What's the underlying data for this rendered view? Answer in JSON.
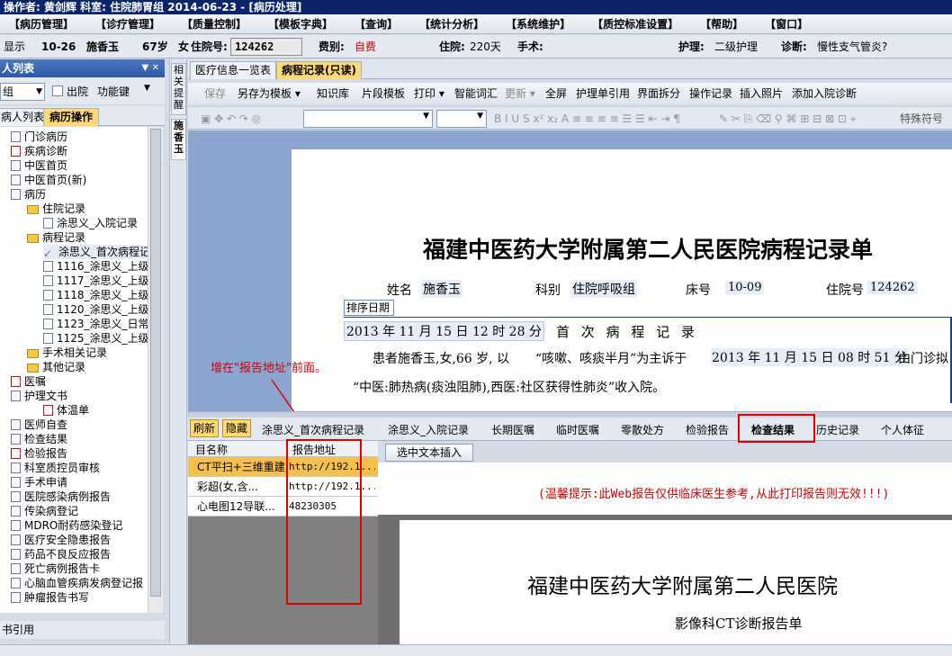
{
  "titlebar": {
    "text": "操作者: 黄剑辉  科室: 住院肺胃组  2014-06-23 - [病历处理]"
  },
  "menu": [
    "【病历管理】",
    "【诊疗管理】",
    "【质量控制】",
    "【模板字典】",
    "【查询】",
    "【统计分析】",
    "【系统维护】",
    "【质控标准设置】",
    "【帮助】",
    "【窗口】"
  ],
  "patient": {
    "show_label": "显示",
    "bed": "10-26",
    "name": "施香玉",
    "age": "67岁",
    "sex_label": "女",
    "admission_no_label": "住院号:",
    "admission_no": "124262",
    "fee_label": "费别:",
    "fee": "自费",
    "inpatient_label": "住院:",
    "inpatient": "220天",
    "surgery_label": "手术:",
    "nursing_label": "护理:",
    "nursing": "二级护理",
    "diagnosis_label": "诊断:",
    "diagnosis": "慢性支气管炎?"
  },
  "left": {
    "header": "人列表",
    "pin": "▼ ✕",
    "group_value": "组",
    "discharged_label": "出院",
    "function_key": "功能键",
    "tabs": [
      "病人列表",
      "病历操作"
    ],
    "tree": [
      {
        "label": "门诊病历",
        "indent": 0,
        "icon": "doc"
      },
      {
        "label": "疾病诊断",
        "indent": 0,
        "icon": "red"
      },
      {
        "label": "中医首页",
        "indent": 0,
        "icon": "doc"
      },
      {
        "label": "中医首页(新)",
        "indent": 0,
        "icon": "doc"
      },
      {
        "label": "病历",
        "indent": 0,
        "icon": "doc"
      },
      {
        "label": "住院记录",
        "indent": 1,
        "icon": "folder"
      },
      {
        "label": "涂思义_入院记录",
        "indent": 2,
        "icon": "doc"
      },
      {
        "label": "病程记录",
        "indent": 1,
        "icon": "folder"
      },
      {
        "label": "涂思义_首次病程记",
        "indent": 2,
        "icon": "check"
      },
      {
        "label": "1116_涂思义_上级",
        "indent": 2,
        "icon": "doc"
      },
      {
        "label": "1117_涂思义_上级",
        "indent": 2,
        "icon": "doc"
      },
      {
        "label": "1118_涂思义_上级",
        "indent": 2,
        "icon": "doc"
      },
      {
        "label": "1120_涂思义_上级",
        "indent": 2,
        "icon": "doc"
      },
      {
        "label": "1123_涂思义_日常",
        "indent": 2,
        "icon": "doc"
      },
      {
        "label": "1125_涂思义_上级",
        "indent": 2,
        "icon": "doc"
      },
      {
        "label": "手术相关记录",
        "indent": 1,
        "icon": "folder"
      },
      {
        "label": "其他记录",
        "indent": 1,
        "icon": "folder"
      },
      {
        "label": "医嘱",
        "indent": 0,
        "icon": "red"
      },
      {
        "label": "护理文书",
        "indent": 0,
        "icon": "doc"
      },
      {
        "label": "体温单",
        "indent": 2,
        "icon": "red"
      },
      {
        "label": "医师自查",
        "indent": 0,
        "icon": "doc"
      },
      {
        "label": "检查结果",
        "indent": 0,
        "icon": "doc"
      },
      {
        "label": "检验报告",
        "indent": 0,
        "icon": "red"
      },
      {
        "label": "科室质控员审核",
        "indent": 0,
        "icon": "doc"
      },
      {
        "label": "手术申请",
        "indent": 0,
        "icon": "doc"
      },
      {
        "label": "医院感染病例报告",
        "indent": 0,
        "icon": "doc"
      },
      {
        "label": "传染病登记",
        "indent": 0,
        "icon": "doc"
      },
      {
        "label": "MDRO耐药感染登记",
        "indent": 0,
        "icon": "doc"
      },
      {
        "label": "医疗安全隐患报告",
        "indent": 0,
        "icon": "doc"
      },
      {
        "label": "药品不良反应报告",
        "indent": 0,
        "icon": "doc"
      },
      {
        "label": "死亡病例报告卡",
        "indent": 0,
        "icon": "doc"
      },
      {
        "label": "心脑血管疾病发病登记报",
        "indent": 0,
        "icon": "doc"
      },
      {
        "label": "肿瘤报告书写",
        "indent": 0,
        "icon": "doc"
      }
    ],
    "footer": "书引用"
  },
  "sidetabs": [
    "相关提醒",
    "施香玉"
  ],
  "doc_tabs": [
    "医疗信息一览表",
    "病程记录(只读)"
  ],
  "toolbar1": [
    "保存",
    "另存为模板 ▾",
    "知识库",
    "片段模板",
    "打印 ▾",
    "智能词汇",
    "更新 ▾",
    "全屏",
    "护理单引用",
    "界面拆分",
    "操作记录",
    "插入照片",
    "添加入院诊断"
  ],
  "toolbar2": {
    "glyphs": "B I U S x² x₂ A ≡ ≡ ≡ ≡ ☰ ☰ ⇤ ⇥ ¶",
    "special_char": "特殊符号"
  },
  "paper": {
    "title": "福建中医药大学附属第二人民医院病程记录单",
    "name_label": "姓名",
    "name": "施香玉",
    "dept_label": "科别",
    "dept": "住院呼吸组",
    "bed_label": "床号",
    "bed": "10-09",
    "admission_label": "住院号",
    "admission": "124262",
    "sort_label": "排序日期",
    "datetime": "2013 年 11 月 15 日 12 时 28 分",
    "record_title": "首 次 病 程 记 录",
    "line1a": "患者施香玉,女,66 岁, 以",
    "line1b": "“咳嗽、咳痰半月”为主诉于",
    "line1c": "2013 年 11 月 15 日 08 时 51 分",
    "line1d": "由门诊拟",
    "line2": "“中医:肺热病(痰浊阻肺),西医:社区获得性肺炎”收入院。"
  },
  "annotation": "增在\"报告地址\"前面。",
  "bottom_tabs": [
    "刷新",
    "隐藏",
    "涂思义_首次病程记录",
    "涂思义_入院记录",
    "长期医嘱",
    "临时医嘱",
    "零散处方",
    "检验报告",
    "检查结果",
    "历史记录",
    "个人体征"
  ],
  "grid": {
    "columns": [
      "目名称",
      "报告地址"
    ],
    "rows": [
      {
        "name": "CT平扫+三维重建",
        "addr": "http://192.1..."
      },
      {
        "name": "彩超(女,含...",
        "addr": "http://192.1..."
      },
      {
        "name": "心电图12导联...",
        "addr": "48230305"
      }
    ]
  },
  "insert_button": "选中文本插入",
  "warm_tip": "(温馨提示:此Web报告仅供临床医生参考,从此打印报告则无效!!!)",
  "report": {
    "title": "福建中医药大学附属第二人民医院",
    "subtitle": "影像科CT诊断报告单"
  }
}
